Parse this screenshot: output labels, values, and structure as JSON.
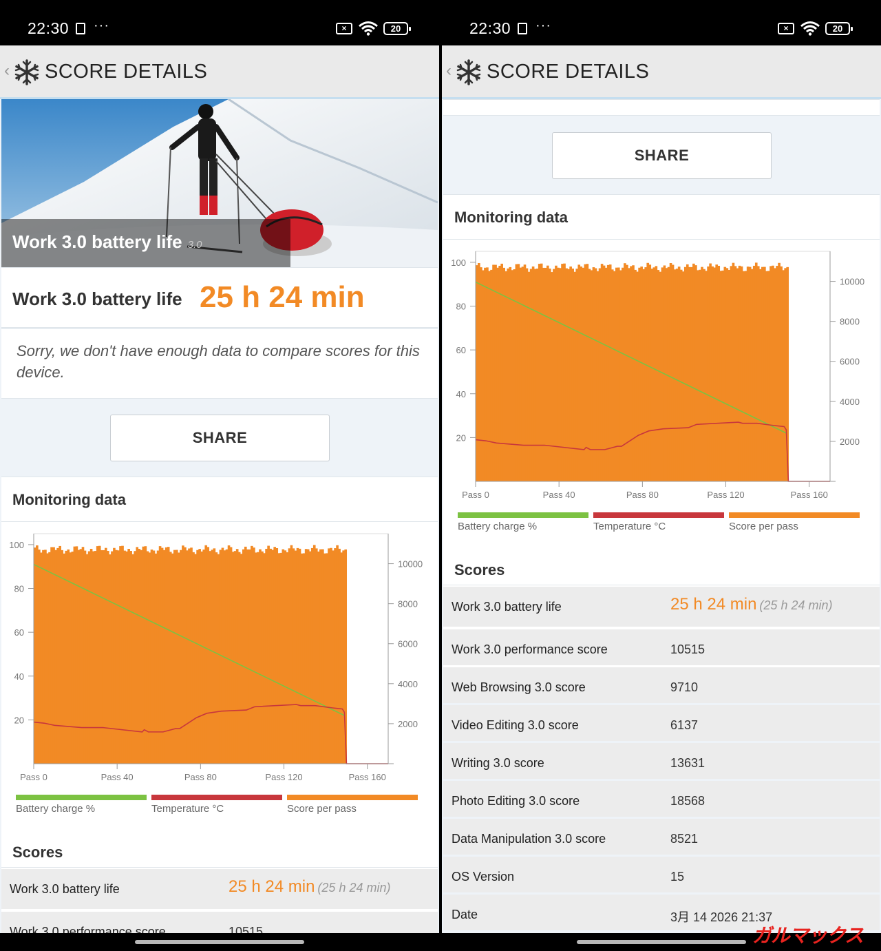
{
  "status": {
    "time": "22:30",
    "dots": "···",
    "battery": "20"
  },
  "app": {
    "back": "‹",
    "title": "SCORE DETAILS"
  },
  "hero": {
    "title": "Work 3.0 battery life",
    "version": "3.0"
  },
  "result": {
    "label": "Work 3.0 battery life",
    "value": "25 h 24 min"
  },
  "sorry_text": "Sorry, we don't have enough data to compare scores for this device.",
  "share_label": "SHARE",
  "monitoring": {
    "title": "Monitoring data",
    "legend": [
      {
        "label": "Battery charge %",
        "color": "#7cc242"
      },
      {
        "label": "Temperature °C",
        "color": "#c8373c"
      },
      {
        "label": "Score per pass",
        "color": "#f28a25"
      }
    ]
  },
  "chart_data": {
    "type": "bar",
    "xlabel": "",
    "ylabel": "",
    "x_ticks": [
      "Pass 0",
      "Pass 40",
      "Pass 80",
      "Pass 120",
      "Pass 160"
    ],
    "xlim": [
      0,
      170
    ],
    "y_left_ticks": [
      20,
      40,
      60,
      80,
      100
    ],
    "y_left_lim": [
      0,
      105
    ],
    "y_right_ticks": [
      2000,
      4000,
      6000,
      8000,
      10000
    ],
    "y_right_lim": [
      0,
      11500
    ],
    "grid": false,
    "legend_position": "bottom",
    "series": [
      {
        "name": "Score per pass",
        "axis": "right",
        "type": "bar",
        "color": "#f28a25",
        "x_range": [
          0,
          149
        ],
        "value_typical": 10700
      },
      {
        "name": "Battery charge %",
        "axis": "left",
        "type": "line",
        "color": "#7cc242",
        "x": [
          0,
          149
        ],
        "y": [
          91,
          22
        ]
      },
      {
        "name": "Temperature °C",
        "axis": "left",
        "type": "line",
        "color": "#c8373c",
        "x": [
          0,
          5,
          10,
          23,
          33,
          52,
          53,
          55,
          62,
          68,
          70,
          78,
          83,
          90,
          102,
          106,
          126,
          128,
          135,
          143,
          148,
          149,
          150,
          170
        ],
        "y": [
          19,
          18.5,
          17.5,
          16.5,
          16.5,
          14.5,
          15.5,
          14.5,
          14.5,
          16,
          16,
          21,
          23,
          24,
          24.5,
          26,
          27,
          26.5,
          26.5,
          25.5,
          25,
          23.5,
          0,
          0
        ]
      }
    ]
  },
  "scores": {
    "title": "Scores",
    "rows": [
      {
        "key": "Work 3.0 battery life",
        "value": "25 h 24 min",
        "sub": "(25 h 24 min)"
      },
      {
        "key": "Work 3.0 performance score",
        "value": "10515"
      },
      {
        "key": "Web Browsing 3.0 score",
        "value": "9710"
      },
      {
        "key": "Video Editing 3.0 score",
        "value": "6137"
      },
      {
        "key": "Writing 3.0 score",
        "value": "13631"
      },
      {
        "key": "Photo Editing 3.0 score",
        "value": "18568"
      },
      {
        "key": "Data Manipulation 3.0 score",
        "value": "8521"
      },
      {
        "key": "OS Version",
        "value": "15"
      },
      {
        "key": "Date",
        "value": "3月 14 2026 21:37"
      }
    ]
  },
  "watermark": "ガルマックス"
}
